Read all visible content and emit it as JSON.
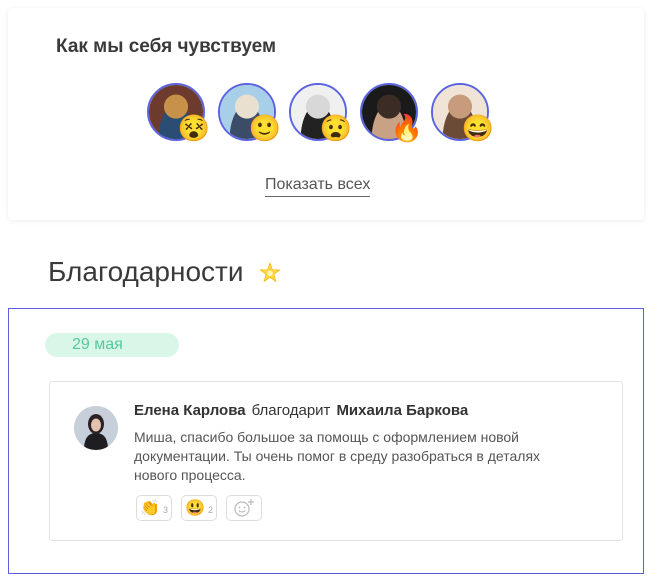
{
  "mood": {
    "title": "Как мы себя чувствуем",
    "show_all": "Показать всех",
    "people": [
      {
        "emoji": "😵",
        "colors": [
          "#6d3b2d",
          "#c8914a",
          "#2b4c73"
        ]
      },
      {
        "emoji": "🙂",
        "colors": [
          "#a8cfe8",
          "#e9e0d0",
          "#3a4c68"
        ]
      },
      {
        "emoji": "😧",
        "colors": [
          "#f0f0f0",
          "#d8d8d8",
          "#222222"
        ]
      },
      {
        "emoji": "🔥",
        "colors": [
          "#1a1a1a",
          "#3b2c25",
          "#c9a184"
        ]
      },
      {
        "emoji": "😄",
        "colors": [
          "#efe4d6",
          "#c89b7c",
          "#6b4a36"
        ]
      }
    ]
  },
  "thanks": {
    "title": "Благодарности",
    "date": "29 мая",
    "post": {
      "author": "Елена Карлова",
      "verb": "благодарит",
      "recipient": "Михаила Баркова",
      "text": "Миша, спасибо большое за помощь с оформлением новой документации. Ты очень помог в среду разобраться в деталях нового процесса.",
      "reactions": [
        {
          "emoji": "👏",
          "count": "3"
        },
        {
          "emoji": "😃",
          "count": "2"
        }
      ]
    }
  },
  "colors": {
    "accent": "#5b5fd9",
    "date_bg": "#d9f7e9",
    "date_text": "#58c99a"
  }
}
